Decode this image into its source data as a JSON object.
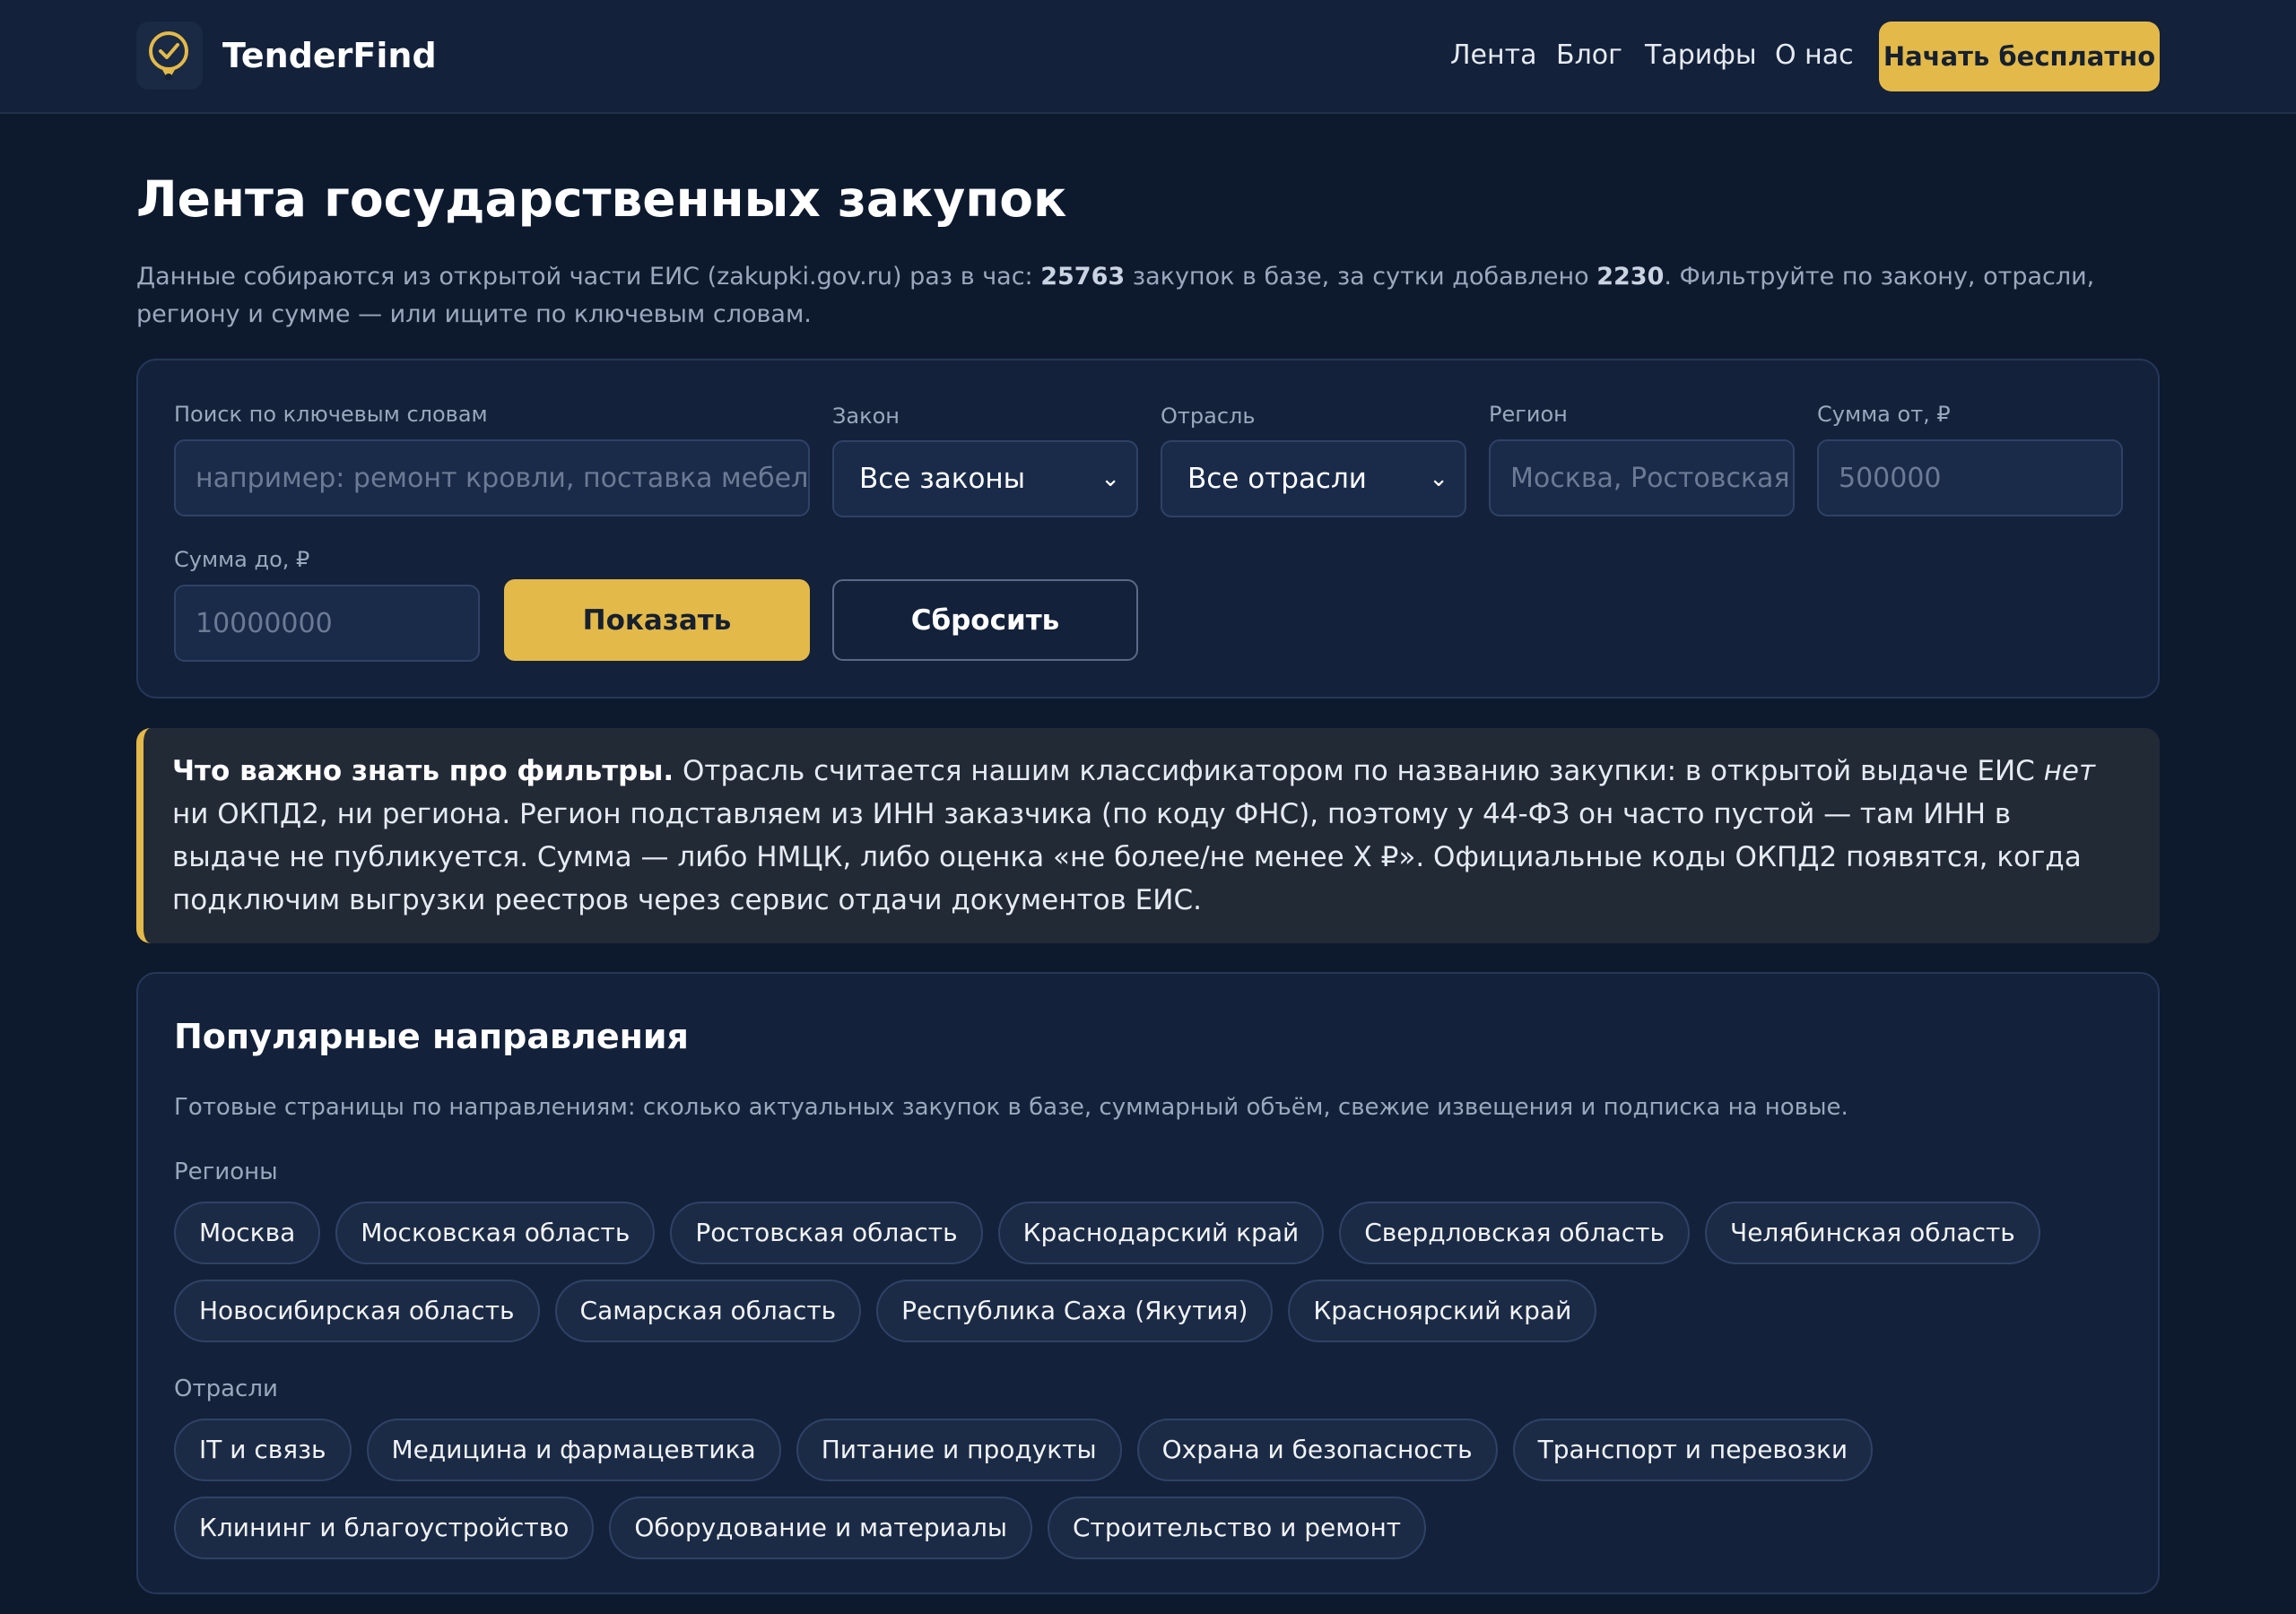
{
  "header": {
    "brand": "TenderFind",
    "nav": [
      "Лента",
      "Блог",
      "Тарифы",
      "О нас"
    ],
    "cta_label": "Начать бесплатно"
  },
  "page": {
    "title": "Лента государственных закупок",
    "lead_part1": "Данные собираются из открытой части ЕИС (zakupki.gov.ru) раз в час: ",
    "total_count": "25763",
    "lead_part2": " закупок в базе, за сутки добавлено ",
    "daily_count": "2230",
    "lead_part3": ". Фильтруйте по закону, отрасли, региону и сумме — или ищите по ключевым словам."
  },
  "filters": {
    "search_label": "Поиск по ключевым словам",
    "search_placeholder": "например: ремонт кровли, поставка мебели",
    "law_label": "Закон",
    "law_value": "Все законы",
    "industry_label": "Отрасль",
    "industry_value": "Все отрасли",
    "region_label": "Регион",
    "region_placeholder": "Москва, Ростовская",
    "sum_from_label": "Сумма от, ₽",
    "sum_from_placeholder": "500000",
    "sum_to_label": "Сумма до, ₽",
    "sum_to_placeholder": "10000000",
    "show_label": "Показать",
    "reset_label": "Сбросить"
  },
  "note": {
    "title": "Что важно знать про фильтры.",
    "text1": " Отрасль считается нашим классификатором по названию закупки: в открытой выдаче ЕИС ",
    "emph": "нет",
    "text2": " ни ОКПД2, ни региона. Регион подставляем из ИНН заказчика (по коду ФНС), поэтому у 44-ФЗ он часто пустой — там ИНН в выдаче не публикуется. Сумма — либо НМЦК, либо оценка «не более/не менее X ₽». Официальные коды ОКПД2 появятся, когда подключим выгрузки реестров через сервис отдачи документов ЕИС."
  },
  "popular": {
    "title": "Популярные направления",
    "subtitle": "Готовые страницы по направлениям: сколько актуальных закупок в базе, суммарный объём, свежие извещения и подписка на новые.",
    "regions_label": "Регионы",
    "regions": [
      "Москва",
      "Московская область",
      "Ростовская область",
      "Краснодарский край",
      "Свердловская область",
      "Челябинская область",
      "Новосибирская область",
      "Самарская область",
      "Республика Саха (Якутия)",
      "Красноярский край"
    ],
    "industries_label": "Отрасли",
    "industries": [
      "IT и связь",
      "Медицина и фармацевтика",
      "Питание и продукты",
      "Охрана и безопасность",
      "Транспорт и перевозки",
      "Клининг и благоустройство",
      "Оборудование и материалы",
      "Строительство и ремонт"
    ]
  },
  "colors": {
    "accent": "#e3b94a",
    "background": "#0d1a2e",
    "panel": "#13213a"
  }
}
